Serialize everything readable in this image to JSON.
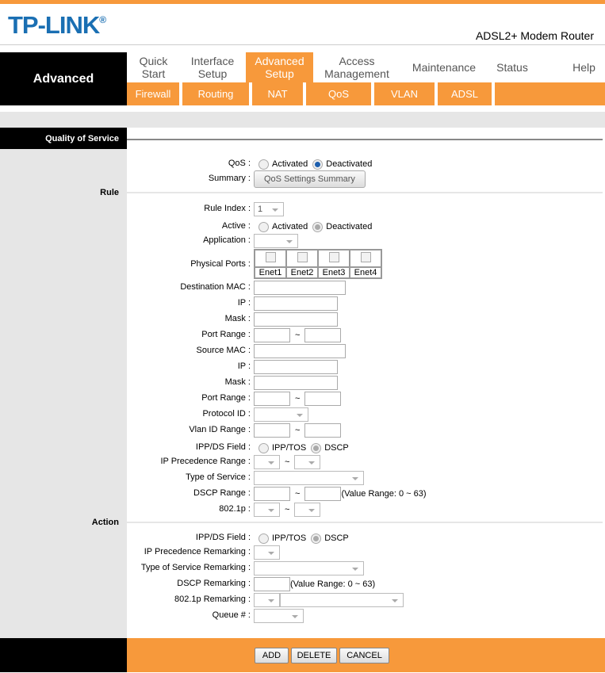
{
  "header": {
    "logo": "TP-LINK",
    "model": "ADSL2+ Modem Router"
  },
  "nav": {
    "section": "Advanced",
    "tabs": [
      {
        "label": "Quick Start"
      },
      {
        "label": "Interface Setup"
      },
      {
        "label": "Advanced Setup",
        "active": true
      },
      {
        "label": "Access Management"
      },
      {
        "label": "Maintenance"
      },
      {
        "label": "Status"
      },
      {
        "label": "Help"
      }
    ],
    "subtabs": [
      "Firewall",
      "Routing",
      "NAT",
      "QoS",
      "VLAN",
      "ADSL"
    ]
  },
  "page": {
    "title": "Quality of Service",
    "sections": {
      "rule": "Rule",
      "action": "Action"
    }
  },
  "qos": {
    "label": "QoS :",
    "options": [
      "Activated",
      "Deactivated"
    ],
    "selected": "Deactivated",
    "summary_label": "Summary :",
    "summary_button": "QoS Settings Summary"
  },
  "rule": {
    "rule_index": {
      "label": "Rule Index :",
      "value": "1"
    },
    "active": {
      "label": "Active :",
      "options": [
        "Activated",
        "Deactivated"
      ],
      "selected": "Deactivated"
    },
    "application": {
      "label": "Application :",
      "value": ""
    },
    "physical_ports": {
      "label": "Physical Ports :",
      "ports": [
        "Enet1",
        "Enet2",
        "Enet3",
        "Enet4"
      ],
      "checked": [
        false,
        false,
        false,
        false
      ]
    },
    "destination_mac": {
      "label": "Destination MAC :",
      "value": ""
    },
    "dest_ip": {
      "label": "IP :",
      "value": ""
    },
    "dest_mask": {
      "label": "Mask :",
      "value": ""
    },
    "dest_port_range": {
      "label": "Port Range :",
      "from": "",
      "to": "",
      "sep": "~"
    },
    "source_mac": {
      "label": "Source MAC :",
      "value": ""
    },
    "src_ip": {
      "label": "IP :",
      "value": ""
    },
    "src_mask": {
      "label": "Mask :",
      "value": ""
    },
    "src_port_range": {
      "label": "Port Range :",
      "from": "",
      "to": "",
      "sep": "~"
    },
    "protocol_id": {
      "label": "Protocol ID :",
      "value": ""
    },
    "vlan_id_range": {
      "label": "Vlan ID Range :",
      "from": "",
      "to": "",
      "sep": "~"
    },
    "ippds_field": {
      "label": "IPP/DS Field :",
      "options": [
        "IPP/TOS",
        "DSCP"
      ],
      "selected": "DSCP"
    },
    "ip_precedence_range": {
      "label": "IP Precedence Range :",
      "sep": "~"
    },
    "type_of_service": {
      "label": "Type of Service :",
      "value": ""
    },
    "dscp_range": {
      "label": "DSCP Range :",
      "from": "",
      "to": "",
      "sep": "~",
      "hint": "(Value Range: 0 ~ 63)"
    },
    "p8021": {
      "label": "802.1p :",
      "sep": "~"
    }
  },
  "action": {
    "ippds_field": {
      "label": "IPP/DS Field :",
      "options": [
        "IPP/TOS",
        "DSCP"
      ],
      "selected": "DSCP"
    },
    "ip_precedence_remarking": {
      "label": "IP Precedence Remarking :"
    },
    "tos_remarking": {
      "label": "Type of Service Remarking :"
    },
    "dscp_remarking": {
      "label": "DSCP Remarking :",
      "value": "",
      "hint": "(Value Range: 0 ~ 63)"
    },
    "p8021_remarking": {
      "label": "802.1p Remarking :"
    },
    "queue": {
      "label": "Queue # :"
    }
  },
  "footer": {
    "add": "ADD",
    "delete": "DELETE",
    "cancel": "CANCEL"
  },
  "colors": {
    "accent": "#f7993b",
    "logo": "#1a6fb3",
    "sidebar": "#e6e6e6"
  }
}
